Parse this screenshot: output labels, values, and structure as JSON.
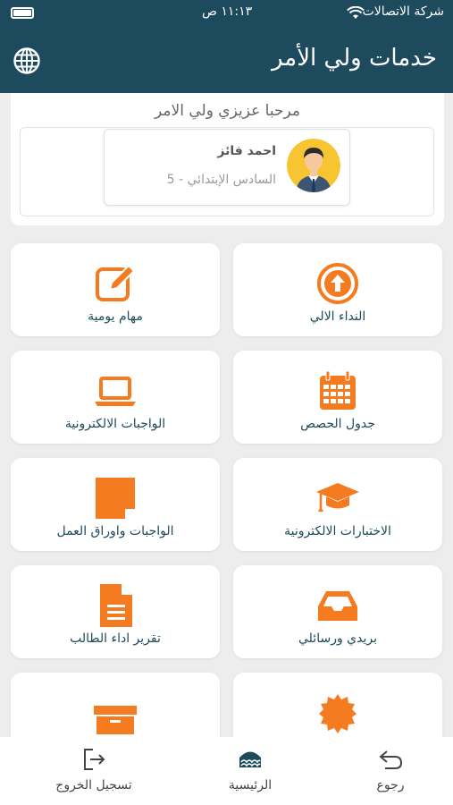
{
  "status_bar": {
    "carrier": "شركة الاتصالات",
    "time": "١١:١٣ ص"
  },
  "header": {
    "title": "خدمات ولي الأمر"
  },
  "welcome": {
    "greeting": "مرحبا عزيزي ولي الامر",
    "student": {
      "name": "احمد فائز",
      "grade": "السادس الإبتدائي - 5"
    }
  },
  "tiles": [
    {
      "label": "النداء الالي",
      "icon": "arrow-up-circle-icon"
    },
    {
      "label": "مهام يومية",
      "icon": "edit-icon"
    },
    {
      "label": "جدول الحصص",
      "icon": "calendar-icon"
    },
    {
      "label": "الواجبات الالكترونية",
      "icon": "laptop-icon"
    },
    {
      "label": "الاختبارات الالكترونية",
      "icon": "graduation-cap-icon"
    },
    {
      "label": "الواجبات واوراق العمل",
      "icon": "sticky-note-icon"
    },
    {
      "label": "بريدي ورسائلي",
      "icon": "inbox-icon"
    },
    {
      "label": "تقرير اداء الطالب",
      "icon": "file-text-icon"
    },
    {
      "label": "",
      "icon": "badge-icon"
    },
    {
      "label": "",
      "icon": "archive-box-icon"
    }
  ],
  "bottom_nav": {
    "back": "رجوع",
    "home": "الرئيسية",
    "logout": "تسجيل الخروج"
  },
  "colors": {
    "header": "#1d4a5c",
    "accent": "#f47b20",
    "label": "#1d4a5c",
    "background": "#ededed"
  }
}
